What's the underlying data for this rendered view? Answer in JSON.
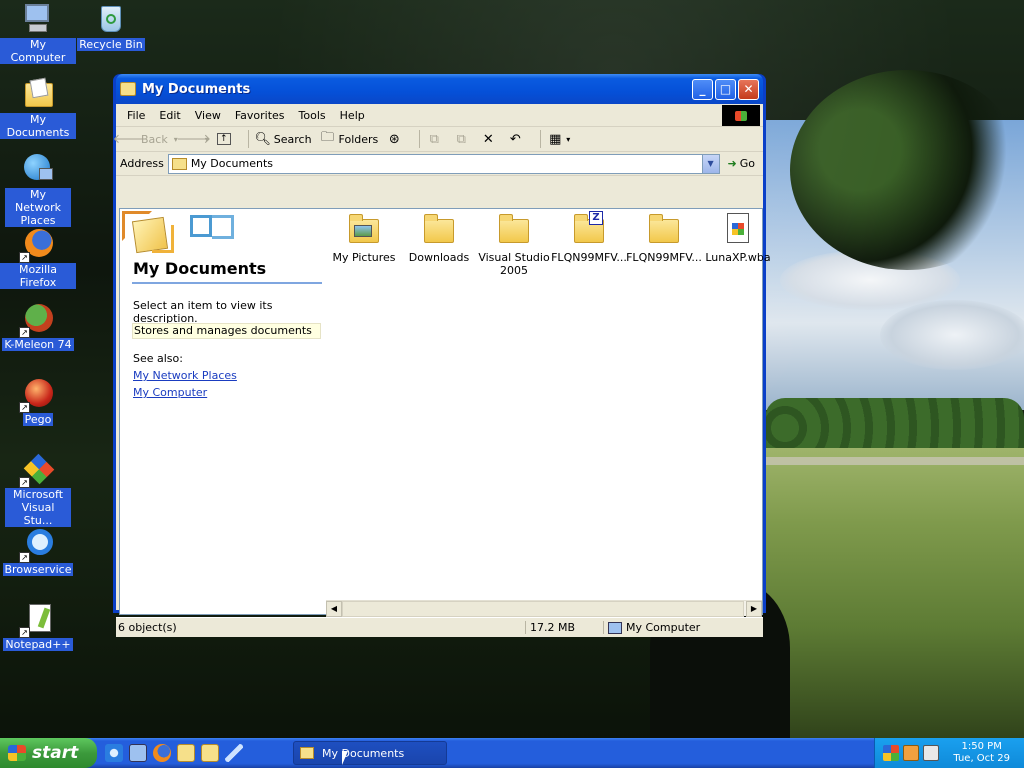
{
  "desktop": {
    "icons": [
      {
        "label": "My Computer",
        "icon": "my-computer-icon"
      },
      {
        "label": "Recycle Bin",
        "icon": "recycle-bin-icon"
      },
      {
        "label": "My Documents",
        "icon": "my-documents-icon"
      },
      {
        "label": "My Network Places",
        "icon": "network-places-icon"
      },
      {
        "label": "Mozilla Firefox",
        "icon": "firefox-icon"
      },
      {
        "label": "K-Meleon 74",
        "icon": "k-meleon-icon"
      },
      {
        "label": "Pego",
        "icon": "pego-icon"
      },
      {
        "label": "Microsoft Visual Stu...",
        "icon": "visual-studio-icon"
      },
      {
        "label": "Browservice",
        "icon": "internet-explorer-icon"
      },
      {
        "label": "Notepad++",
        "icon": "notepad-plus-plus-icon"
      }
    ]
  },
  "window": {
    "title": "My Documents",
    "menu": [
      "File",
      "Edit",
      "View",
      "Favorites",
      "Tools",
      "Help"
    ],
    "toolbar": {
      "back": "Back",
      "search": "Search",
      "folders": "Folders"
    },
    "address": {
      "label": "Address",
      "value": "My Documents",
      "go": "Go"
    },
    "tasks": {
      "title": "My Documents",
      "description": "Select an item to view its description.",
      "info": "Stores and manages documents",
      "see_also": "See also:",
      "links": [
        "My Network Places",
        "My Computer"
      ]
    },
    "files": [
      {
        "name": "My Pictures",
        "type": "pictures-folder"
      },
      {
        "name": "Downloads",
        "type": "folder"
      },
      {
        "name": "Visual Studio 2005",
        "type": "folder"
      },
      {
        "name": "FLQN99MFV...",
        "type": "zipped-folder"
      },
      {
        "name": "FLQN99MFV...",
        "type": "folder"
      },
      {
        "name": "LunaXP.wba",
        "type": "wba-file"
      }
    ],
    "status": {
      "count": "6 object(s)",
      "size": "17.2 MB",
      "location": "My Computer"
    }
  },
  "taskbar": {
    "start": "start",
    "task": "My Documents",
    "clock": {
      "time": "1:50 PM",
      "date": "Tue, Oct 29"
    }
  },
  "colors": {
    "accent": "#0a3fc8",
    "taskbar": "#245edc",
    "start": "#3c9a3c",
    "link": "#1a3cc0"
  }
}
